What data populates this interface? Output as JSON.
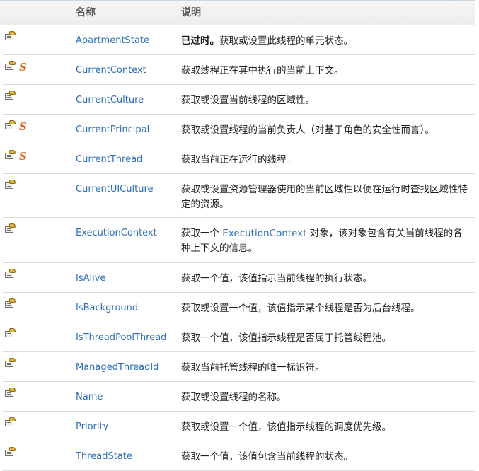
{
  "header": {
    "name_label": "名称",
    "desc_label": "说明"
  },
  "rows": [
    {
      "name": "ApartmentState",
      "static": false,
      "obsolete_prefix": "已过时。",
      "description": "获取或设置此线程的单元状态。"
    },
    {
      "name": "CurrentContext",
      "static": true,
      "static_glyph": "S",
      "description": "获取线程正在其中执行的当前上下文。"
    },
    {
      "name": "CurrentCulture",
      "static": false,
      "description": "获取或设置当前线程的区域性。"
    },
    {
      "name": "CurrentPrincipal",
      "static": true,
      "static_glyph": "S",
      "description": "获取或设置线程的当前负责人（对基于角色的安全性而言）。"
    },
    {
      "name": "CurrentThread",
      "static": true,
      "static_glyph": "S",
      "description": "获取当前正在运行的线程。"
    },
    {
      "name": "CurrentUICulture",
      "static": false,
      "description": "获取或设置资源管理器使用的当前区域性以便在运行时查找区域性特定的资源。"
    },
    {
      "name": "ExecutionContext",
      "static": false,
      "desc_before": "获取一个 ",
      "desc_link": "ExecutionContext",
      "desc_after": " 对象，该对象包含有关当前线程的各种上下文的信息。"
    },
    {
      "name": "IsAlive",
      "static": false,
      "description": "获取一个值，该值指示当前线程的执行状态。"
    },
    {
      "name": "IsBackground",
      "static": false,
      "description": "获取或设置一个值，该值指示某个线程是否为后台线程。"
    },
    {
      "name": "IsThreadPoolThread",
      "static": false,
      "description": "获取一个值，该值指示线程是否属于托管线程池。"
    },
    {
      "name": "ManagedThreadId",
      "static": false,
      "description": "获取当前托管线程的唯一标识符。"
    },
    {
      "name": "Name",
      "static": false,
      "description": "获取或设置线程的名称。"
    },
    {
      "name": "Priority",
      "static": false,
      "description": "获取或设置一个值，该值指示线程的调度优先级。"
    },
    {
      "name": "ThreadState",
      "static": false,
      "description": "获取一个值，该值包含当前线程的状态。"
    }
  ]
}
